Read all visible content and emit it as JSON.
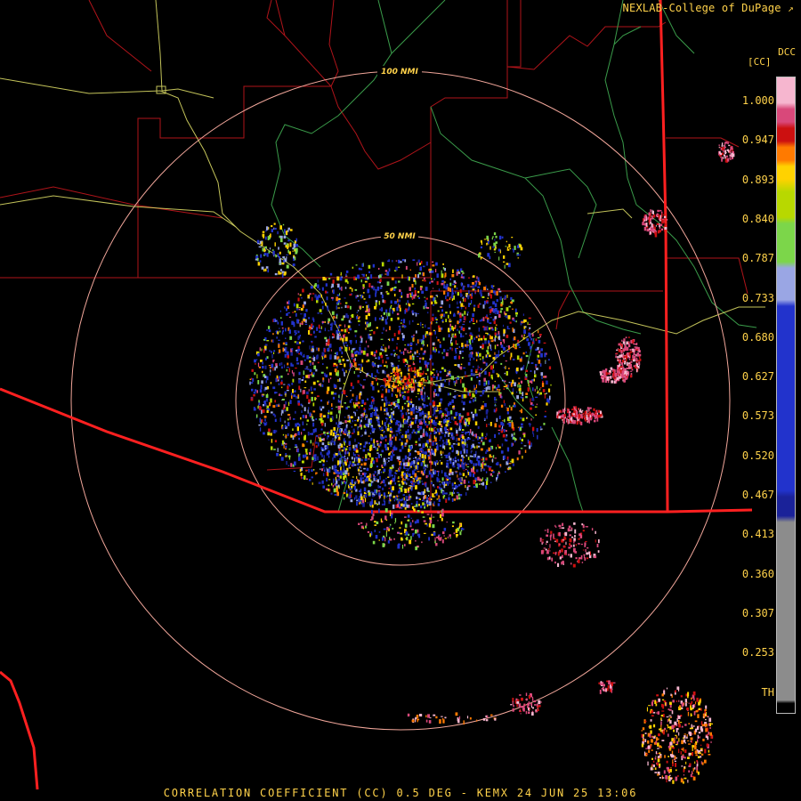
{
  "brand": "NEXLAB-College of DuPage",
  "brand_icon": "external-link-icon",
  "product_code": "DCC",
  "legend": {
    "unit": "[CC]",
    "ticks": [
      "1.000",
      "0.947",
      "0.893",
      "0.840",
      "0.787",
      "0.733",
      "0.680",
      "0.627",
      "0.573",
      "0.520",
      "0.467",
      "0.413",
      "0.360",
      "0.307",
      "0.253",
      "TH"
    ],
    "colors": {
      "pink_top": "#f6b6cf",
      "magenta": "#d9487a",
      "red": "#cc1010",
      "orange": "#ff7a00",
      "yellow": "#ffd200",
      "yellowgreen": "#b8d800",
      "green": "#7cd64a",
      "lavender": "#9aa6e4",
      "blue": "#2233cc",
      "navy": "#1a2299",
      "gray": "#8c8c8c",
      "black": "#000000"
    }
  },
  "range_rings": [
    {
      "label": "100 NMI"
    },
    {
      "label": "50 NMI"
    }
  ],
  "map_colors": {
    "county_lines": "#b0141a",
    "state_border": "#ff2020",
    "highways": "#e6e66a",
    "rivers": "#3a9b4a",
    "rings": "#f1a69a"
  },
  "footer": "CORRELATION COEFFICIENT (CC) 0.5 DEG - KEMX 24 JUN 25 13:06"
}
